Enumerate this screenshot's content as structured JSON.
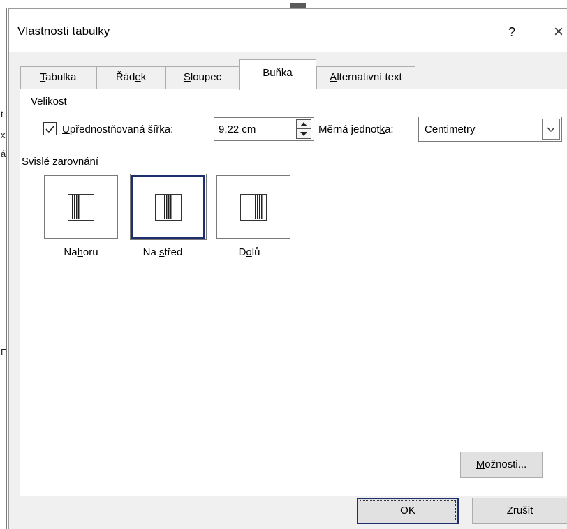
{
  "dialog": {
    "title": "Vlastnosti tabulky",
    "help": "?",
    "close": "×"
  },
  "tabs": [
    {
      "pre": "",
      "key": "T",
      "post": "abulka"
    },
    {
      "pre": "Řád",
      "key": "e",
      "post": "k"
    },
    {
      "pre": "",
      "key": "S",
      "post": "loupec"
    },
    {
      "pre": "",
      "key": "B",
      "post": "uňka",
      "active": true
    },
    {
      "pre": "",
      "key": "A",
      "post": "lternativní text"
    }
  ],
  "size_group": {
    "label": "Velikost",
    "checked": true,
    "pref_width": {
      "pre": "",
      "key": "U",
      "post": "přednostňovaná šířka:"
    },
    "width_value": "9,22 cm",
    "unit_label": {
      "pre": "Měrná jednot",
      "key": "k",
      "post": "a:"
    },
    "unit_value": "Centimetry"
  },
  "align_group": {
    "label": "Svislé zarovnání",
    "options": [
      {
        "pre": "Na",
        "key": "h",
        "post": "oru"
      },
      {
        "pre": "Na ",
        "key": "s",
        "post": "třed",
        "selected": true
      },
      {
        "pre": "D",
        "key": "o",
        "post": "lů"
      }
    ]
  },
  "buttons": {
    "options": {
      "pre": "",
      "key": "M",
      "post": "ožnosti..."
    },
    "ok": "OK",
    "cancel": "Zrušit"
  },
  "background": {
    "fragments": [
      "t",
      "x",
      "á",
      "E"
    ]
  },
  "colors": {
    "dialog_bg": "#f0f0f0",
    "panel_bg": "#ffffff",
    "selected_border": "#1e2f6e"
  }
}
